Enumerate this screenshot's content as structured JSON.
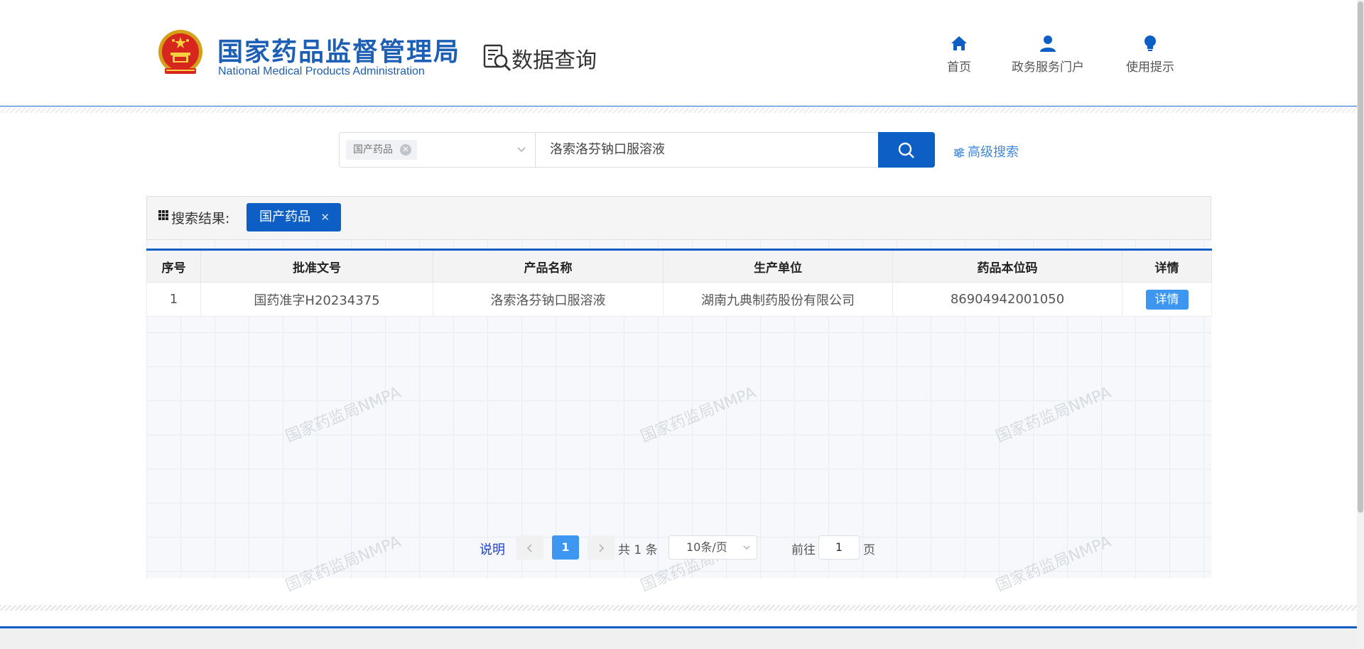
{
  "header": {
    "logo_cn": "国家药品监督管理局",
    "logo_en": "National Medical Products Administration",
    "page_title": "数据查询",
    "nav": [
      {
        "label": "首页",
        "icon": "home-icon"
      },
      {
        "label": "政务服务门户",
        "icon": "user-icon"
      },
      {
        "label": "使用提示",
        "icon": "lightbulb-icon"
      }
    ]
  },
  "search": {
    "category_tag": "国产药品",
    "query": "洛索洛芬钠口服溶液",
    "advanced_label": "高级搜索"
  },
  "results": {
    "label": "搜索结果:",
    "active_tag": "国产药品",
    "columns": [
      "序号",
      "批准文号",
      "产品名称",
      "生产单位",
      "药品本位码",
      "详情"
    ],
    "rows": [
      {
        "index": "1",
        "approval_no": "国药准字H20234375",
        "product": "洛索洛芬钠口服溶液",
        "manufacturer": "湖南九典制药股份有限公司",
        "drug_code": "86904942001050",
        "detail": "详情"
      }
    ],
    "watermark": "国家药监局NMPA"
  },
  "pagination": {
    "note": "说明",
    "current_page": "1",
    "total": "共 1 条",
    "page_size": "10条/页",
    "goto_prefix": "前往",
    "goto_value": "1",
    "goto_suffix": "页"
  },
  "colors": {
    "primary": "#0d5fc6",
    "accent": "#3d96f0",
    "brand_text": "#1d5fb4"
  }
}
